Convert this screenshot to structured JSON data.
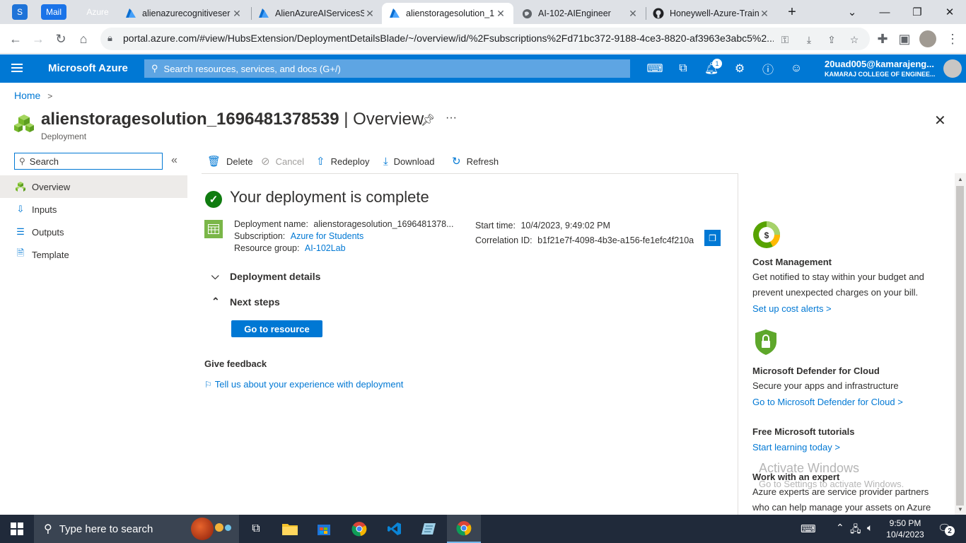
{
  "browser": {
    "pinned": [
      {
        "label": "S",
        "color": "#1e73d8"
      },
      {
        "label": "Mail",
        "color": "#d93025"
      },
      {
        "label": "Azure",
        "color": "#1a73e8"
      }
    ],
    "tabs": [
      {
        "title": "alienazurecognitiveser",
        "icon": "azure-icon"
      },
      {
        "title": "AlienAzureAIServicesS",
        "icon": "azure-icon"
      },
      {
        "title": "alienstoragesolution_1",
        "icon": "azure-icon",
        "active": true
      },
      {
        "title": "AI-102-AIEngineer",
        "icon": "globe-icon"
      },
      {
        "title": "Honeywell-Azure-Train",
        "icon": "github-icon"
      }
    ],
    "new_tab": "+",
    "url": "portal.azure.com/#view/HubsExtension/DeploymentDetailsBlade/~/overview/id/%2Fsubscriptions%2Fd71bc372-9188-4ce3-8820-af3963e3abc5%2..."
  },
  "header": {
    "brand": "Microsoft Azure",
    "search_placeholder": "Search resources, services, and docs (G+/)",
    "notification_count": "1",
    "user": "20uad005@kamarajeng...",
    "org": "KAMARAJ COLLEGE OF ENGINEE..."
  },
  "breadcrumb": {
    "home": "Home",
    "sep": ">"
  },
  "page": {
    "title": "alienstoragesolution_1696481378539",
    "section": "| Overview",
    "subtitle": "Deployment"
  },
  "sidebar": {
    "search_placeholder": "Search",
    "collapse": "«",
    "items": [
      {
        "label": "Overview",
        "icon": "deployment-icon",
        "selected": true
      },
      {
        "label": "Inputs",
        "icon": "inputs-icon"
      },
      {
        "label": "Outputs",
        "icon": "outputs-icon"
      },
      {
        "label": "Template",
        "icon": "template-icon"
      }
    ]
  },
  "commands": {
    "delete": "Delete",
    "cancel": "Cancel",
    "redeploy": "Redeploy",
    "download": "Download",
    "refresh": "Refresh"
  },
  "deployment": {
    "status": "Your deployment is complete",
    "name_label": "Deployment name:",
    "name_value": "alienstoragesolution_1696481378...",
    "subscription_label": "Subscription:",
    "subscription_value": "Azure for Students",
    "rg_label": "Resource group:",
    "rg_value": "AI-102Lab",
    "start_label": "Start time:",
    "start_value": "10/4/2023, 9:49:02 PM",
    "corr_label": "Correlation ID:",
    "corr_value": "b1f21e7f-4098-4b3e-a156-fe1efc4f210a",
    "details_toggle": "Deployment details",
    "next_toggle": "Next steps",
    "go_button": "Go to resource",
    "feedback_title": "Give feedback",
    "feedback_link": "Tell us about your experience with deployment"
  },
  "right_panel": {
    "cost": {
      "title": "Cost Management",
      "text": "Get notified to stay within your budget and prevent unexpected charges on your bill.",
      "link": "Set up cost alerts >"
    },
    "defender": {
      "title": "Microsoft Defender for Cloud",
      "text": "Secure your apps and infrastructure",
      "link": "Go to Microsoft Defender for Cloud >"
    },
    "tutorials": {
      "title": "Free Microsoft tutorials",
      "link": "Start learning today >"
    },
    "expert": {
      "title": "Work with an expert",
      "text": "Azure experts are service provider partners who can help manage your assets on Azure"
    }
  },
  "watermark": {
    "title": "Activate Windows",
    "text": "Go to Settings to activate Windows."
  },
  "taskbar": {
    "search_placeholder": "Type here to search",
    "time": "9:50 PM",
    "date": "10/4/2023",
    "notif_count": "2"
  }
}
